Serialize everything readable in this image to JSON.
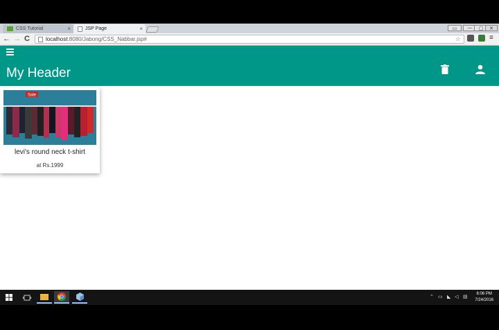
{
  "browser": {
    "tabs": [
      {
        "label": "CSS Tutorial",
        "close": "×"
      },
      {
        "label": "JSP Page",
        "close": "×"
      }
    ],
    "address": {
      "host": "localhost",
      "path": ":8080/Jabong/CSS_Nabbar.jsp#"
    },
    "window_buttons": [
      "▭",
      "—",
      "▢",
      "✕"
    ]
  },
  "app": {
    "title": "My Header",
    "menu_icon": "hamburger-menu-icon",
    "actions": [
      "trash-icon",
      "person-icon"
    ],
    "color": "#009688"
  },
  "products": [
    {
      "name": "levi's round neck t-shirt",
      "price": "at Rs.1999",
      "image_label": "Sale"
    }
  ],
  "taskbar": {
    "clock_time": "6:06 PM",
    "clock_date": "7/24/2016"
  }
}
